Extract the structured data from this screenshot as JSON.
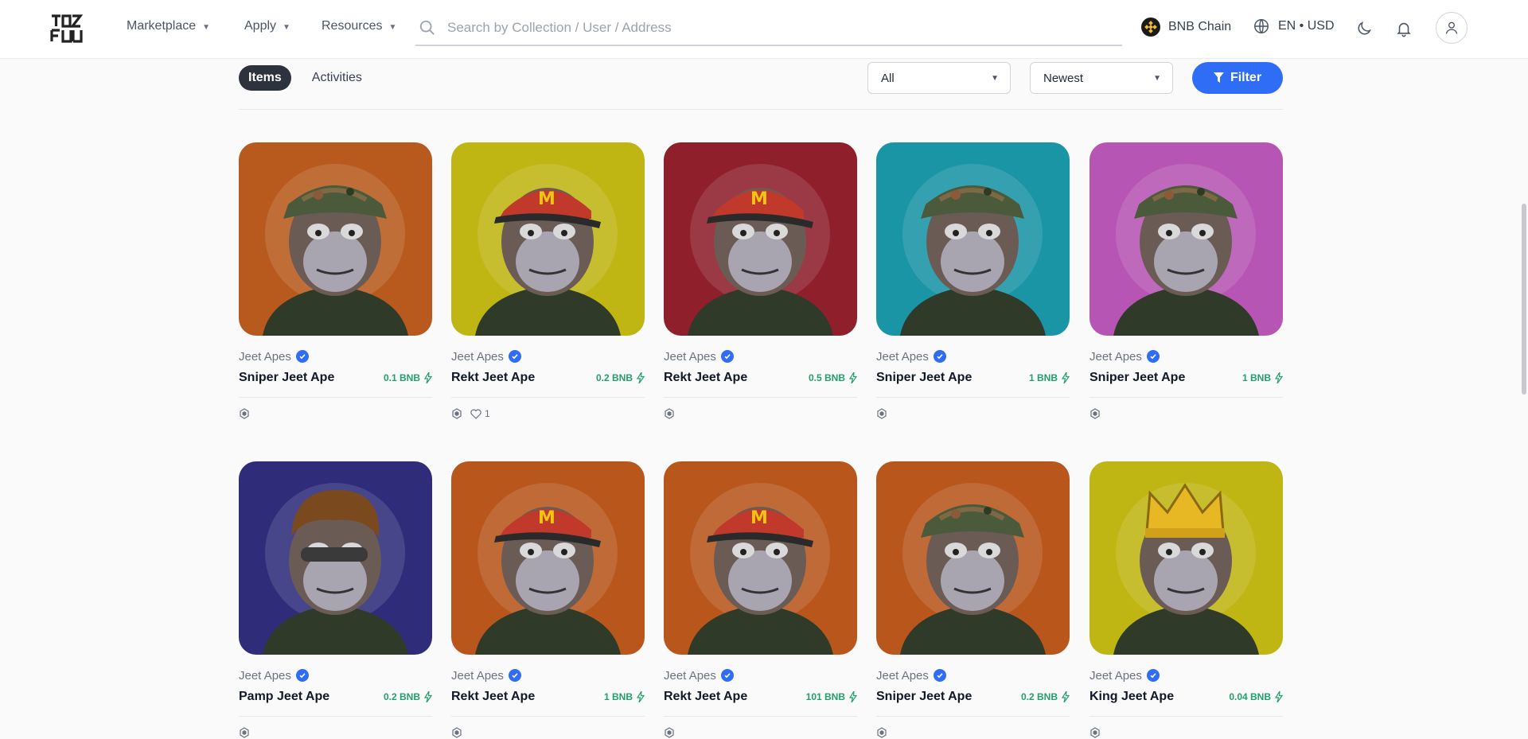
{
  "header": {
    "nav": [
      "Marketplace",
      "Apply",
      "Resources"
    ],
    "search_placeholder": "Search by Collection / User / Address",
    "chain": "BNB Chain",
    "lang_currency": "EN • USD"
  },
  "toolbar": {
    "tabs": [
      "Items",
      "Activities"
    ],
    "type_filter": "All",
    "sort": "Newest",
    "filter_label": "Filter"
  },
  "items": [
    {
      "collection": "Jeet Apes",
      "name": "Sniper Jeet Ape",
      "price": "0.1 BNB",
      "likes": "",
      "bg": "#b85a1d",
      "theme": "sniper"
    },
    {
      "collection": "Jeet Apes",
      "name": "Rekt Jeet Ape",
      "price": "0.2 BNB",
      "likes": "1",
      "bg": "#bfb613",
      "theme": "rekt"
    },
    {
      "collection": "Jeet Apes",
      "name": "Rekt Jeet Ape",
      "price": "0.5 BNB",
      "likes": "",
      "bg": "#8e1f2b",
      "theme": "rekt"
    },
    {
      "collection": "Jeet Apes",
      "name": "Sniper Jeet Ape",
      "price": "1 BNB",
      "likes": "",
      "bg": "#1a95a6",
      "theme": "sniper"
    },
    {
      "collection": "Jeet Apes",
      "name": "Sniper Jeet Ape",
      "price": "1 BNB",
      "likes": "",
      "bg": "#b755b4",
      "theme": "sniper"
    },
    {
      "collection": "Jeet Apes",
      "name": "Pamp Jeet Ape",
      "price": "0.2 BNB",
      "likes": "",
      "bg": "#2f2d7a",
      "theme": "pamp"
    },
    {
      "collection": "Jeet Apes",
      "name": "Rekt Jeet Ape",
      "price": "1 BNB",
      "likes": "",
      "bg": "#b8561c",
      "theme": "rekt"
    },
    {
      "collection": "Jeet Apes",
      "name": "Rekt Jeet Ape",
      "price": "101 BNB",
      "likes": "",
      "bg": "#b8561c",
      "theme": "rekt"
    },
    {
      "collection": "Jeet Apes",
      "name": "Sniper Jeet Ape",
      "price": "0.2 BNB",
      "likes": "",
      "bg": "#b8561c",
      "theme": "sniper"
    },
    {
      "collection": "Jeet Apes",
      "name": "King Jeet Ape",
      "price": "0.04 BNB",
      "likes": "",
      "bg": "#bfb613",
      "theme": "king"
    }
  ]
}
